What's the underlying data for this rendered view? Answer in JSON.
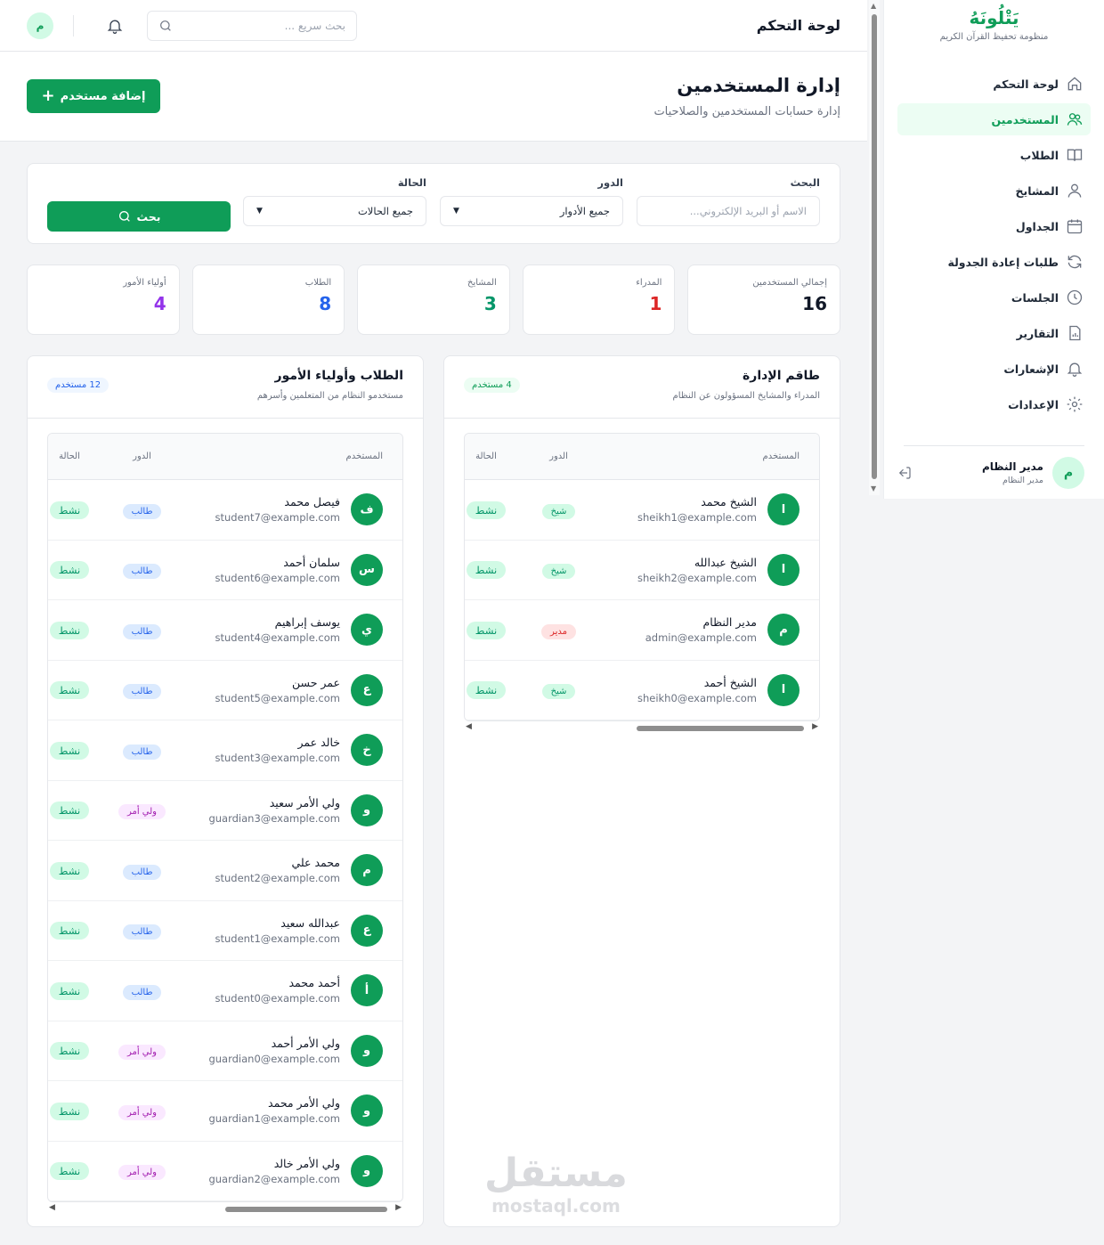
{
  "sidebar": {
    "logo_title": "يَتْلُونَهُ",
    "logo_subtitle": "منظومة تحفيظ القرآن الكريم",
    "items": [
      {
        "label": "لوحة التحكم",
        "icon": "home-icon"
      },
      {
        "label": "المستخدمين",
        "icon": "users-icon",
        "active": true
      },
      {
        "label": "الطلاب",
        "icon": "book-icon"
      },
      {
        "label": "المشايخ",
        "icon": "user-icon"
      },
      {
        "label": "الجداول",
        "icon": "calendar-icon"
      },
      {
        "label": "طلبات إعادة الجدولة",
        "icon": "refresh-icon"
      },
      {
        "label": "الجلسات",
        "icon": "clock-icon"
      },
      {
        "label": "التقارير",
        "icon": "report-icon"
      },
      {
        "label": "الإشعارات",
        "icon": "bell-icon"
      },
      {
        "label": "الإعدادات",
        "icon": "gear-icon"
      }
    ],
    "user": {
      "initial": "م",
      "name": "مدير النظام",
      "role": "مدير النظام"
    }
  },
  "topbar": {
    "title": "لوحة التحكم",
    "search_placeholder": "بحث سريع ...",
    "avatar_initial": "م"
  },
  "header": {
    "title": "إدارة المستخدمين",
    "subtitle": "إدارة حسابات المستخدمين والصلاحيات",
    "add_button": "إضافة مستخدم"
  },
  "filters": {
    "search_label": "البحث",
    "search_placeholder": "الاسم أو البريد الإلكتروني...",
    "role_label": "الدور",
    "role_value": "جميع الأدوار",
    "status_label": "الحالة",
    "status_value": "جميع الحالات",
    "search_button": "بحث"
  },
  "stats": [
    {
      "label": "إجمالي المستخدمين",
      "value": "16",
      "color": "#111827"
    },
    {
      "label": "المدراء",
      "value": "1",
      "color": "#dc2626"
    },
    {
      "label": "المشايخ",
      "value": "3",
      "color": "#059669"
    },
    {
      "label": "الطلاب",
      "value": "8",
      "color": "#2563eb"
    },
    {
      "label": "أولياء الأمور",
      "value": "4",
      "color": "#9333ea"
    }
  ],
  "admin_panel": {
    "title": "طاقم الإدارة",
    "subtitle": "المدراء والمشايخ المسؤولون عن النظام",
    "badge": "4 مستخدم",
    "columns": {
      "user": "المستخدم",
      "role": "الدور",
      "status": "الحالة"
    },
    "rows": [
      {
        "initial": "ا",
        "name": "الشيخ محمد",
        "email": "sheikh1@example.com",
        "role": "شيخ",
        "role_type": "sheikh",
        "status": "نشط"
      },
      {
        "initial": "ا",
        "name": "الشيخ عبدالله",
        "email": "sheikh2@example.com",
        "role": "شيخ",
        "role_type": "sheikh",
        "status": "نشط"
      },
      {
        "initial": "م",
        "name": "مدير النظام",
        "email": "admin@example.com",
        "role": "مدير",
        "role_type": "admin",
        "status": "نشط"
      },
      {
        "initial": "ا",
        "name": "الشيخ أحمد",
        "email": "sheikh0@example.com",
        "role": "شيخ",
        "role_type": "sheikh",
        "status": "نشط"
      }
    ]
  },
  "students_panel": {
    "title": "الطلاب وأولياء الأمور",
    "subtitle": "مستخدمو النظام من المتعلمين وأسرهم",
    "badge": "12 مستخدم",
    "columns": {
      "user": "المستخدم",
      "role": "الدور",
      "status": "الحالة"
    },
    "rows": [
      {
        "initial": "ف",
        "name": "فيصل محمد",
        "email": "student7@example.com",
        "role": "طالب",
        "role_type": "student",
        "status": "نشط"
      },
      {
        "initial": "س",
        "name": "سلمان أحمد",
        "email": "student6@example.com",
        "role": "طالب",
        "role_type": "student",
        "status": "نشط"
      },
      {
        "initial": "ي",
        "name": "يوسف إبراهيم",
        "email": "student4@example.com",
        "role": "طالب",
        "role_type": "student",
        "status": "نشط"
      },
      {
        "initial": "ع",
        "name": "عمر حسن",
        "email": "student5@example.com",
        "role": "طالب",
        "role_type": "student",
        "status": "نشط"
      },
      {
        "initial": "خ",
        "name": "خالد عمر",
        "email": "student3@example.com",
        "role": "طالب",
        "role_type": "student",
        "status": "نشط"
      },
      {
        "initial": "و",
        "name": "ولي الأمر سعيد",
        "email": "guardian3@example.com",
        "role": "ولي أمر",
        "role_type": "guardian",
        "status": "نشط"
      },
      {
        "initial": "م",
        "name": "محمد علي",
        "email": "student2@example.com",
        "role": "طالب",
        "role_type": "student",
        "status": "نشط"
      },
      {
        "initial": "ع",
        "name": "عبدالله سعيد",
        "email": "student1@example.com",
        "role": "طالب",
        "role_type": "student",
        "status": "نشط"
      },
      {
        "initial": "أ",
        "name": "أحمد محمد",
        "email": "student0@example.com",
        "role": "طالب",
        "role_type": "student",
        "status": "نشط"
      },
      {
        "initial": "و",
        "name": "ولي الأمر أحمد",
        "email": "guardian0@example.com",
        "role": "ولي أمر",
        "role_type": "guardian",
        "status": "نشط"
      },
      {
        "initial": "و",
        "name": "ولي الأمر محمد",
        "email": "guardian1@example.com",
        "role": "ولي أمر",
        "role_type": "guardian",
        "status": "نشط"
      },
      {
        "initial": "و",
        "name": "ولي الأمر خالد",
        "email": "guardian2@example.com",
        "role": "ولي أمر",
        "role_type": "guardian",
        "status": "نشط"
      }
    ]
  },
  "watermark": {
    "line1": "مستقل",
    "line2": "mostaql.com"
  }
}
